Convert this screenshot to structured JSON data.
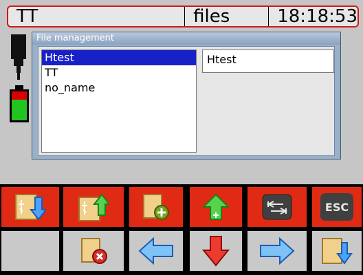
{
  "statusbar": {
    "title": "TT",
    "mode": "files",
    "time": "18:18:53"
  },
  "dialog": {
    "title": "File management",
    "files": [
      "Htest",
      "TT",
      "no_name"
    ],
    "selected_file": "Htest",
    "preview_name": "Htest"
  },
  "buttons": {
    "row1": [
      {
        "name": "usb-import-button",
        "icon": "usb-down-file-icon"
      },
      {
        "name": "usb-export-button",
        "icon": "usb-up-file-icon"
      },
      {
        "name": "new-file-button",
        "icon": "file-add-icon"
      },
      {
        "name": "add-up-button",
        "icon": "arrow-up-plus-icon"
      },
      {
        "name": "tab-button",
        "icon": "tab-icon"
      },
      {
        "name": "esc-button",
        "icon": "esc-icon",
        "label": "ESC"
      }
    ],
    "row2": [
      {
        "name": "empty-button",
        "icon": ""
      },
      {
        "name": "delete-file-button",
        "icon": "file-delete-icon"
      },
      {
        "name": "left-button",
        "icon": "arrow-left-icon"
      },
      {
        "name": "down-button",
        "icon": "arrow-down-icon"
      },
      {
        "name": "right-button",
        "icon": "arrow-right-icon"
      },
      {
        "name": "save-file-button",
        "icon": "file-down-icon"
      }
    ]
  },
  "colors": {
    "red": "#e02a14",
    "status_border": "#d01818",
    "selection": "#1820c8"
  }
}
